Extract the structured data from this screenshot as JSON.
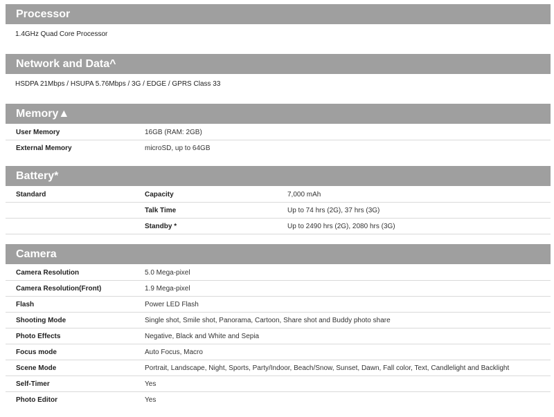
{
  "processor": {
    "title": "Processor",
    "text": "1.4GHz Quad Core Processor"
  },
  "network": {
    "title": "Network and Data^",
    "text": "HSDPA 21Mbps / HSUPA 5.76Mbps / 3G / EDGE / GPRS Class 33"
  },
  "memory": {
    "title": "Memory▲",
    "rows": [
      {
        "label": "User Memory",
        "value": "16GB (RAM: 2GB)"
      },
      {
        "label": "External Memory",
        "value": "microSD, up to 64GB"
      }
    ]
  },
  "battery": {
    "title": "Battery*",
    "standard_label": "Standard",
    "rows": [
      {
        "label": "Capacity",
        "value": "7,000 mAh"
      },
      {
        "label": "Talk Time",
        "value": "Up to 74 hrs (2G), 37 hrs (3G)"
      },
      {
        "label": "Standby *",
        "value": "Up to 2490 hrs (2G), 2080 hrs (3G)"
      }
    ]
  },
  "camera": {
    "title": "Camera",
    "rows": [
      {
        "label": "Camera Resolution",
        "value": "5.0 Mega-pixel"
      },
      {
        "label": "Camera Resolution(Front)",
        "value": "1.9 Mega-pixel"
      },
      {
        "label": "Flash",
        "value": "Power LED Flash"
      },
      {
        "label": "Shooting Mode",
        "value": "Single shot, Smile shot, Panorama, Cartoon, Share shot and Buddy photo share"
      },
      {
        "label": "Photo Effects",
        "value": "Negative, Black and White and Sepia"
      },
      {
        "label": "Focus mode",
        "value": "Auto Focus, Macro"
      },
      {
        "label": "Scene Mode",
        "value": "Portrait, Landscape, Night, Sports, Party/Indoor, Beach/Snow, Sunset, Dawn, Fall color, Text, Candlelight and Backlight"
      },
      {
        "label": "Self-Timer",
        "value": "Yes"
      },
      {
        "label": "Photo Editor",
        "value": "Yes"
      }
    ]
  }
}
